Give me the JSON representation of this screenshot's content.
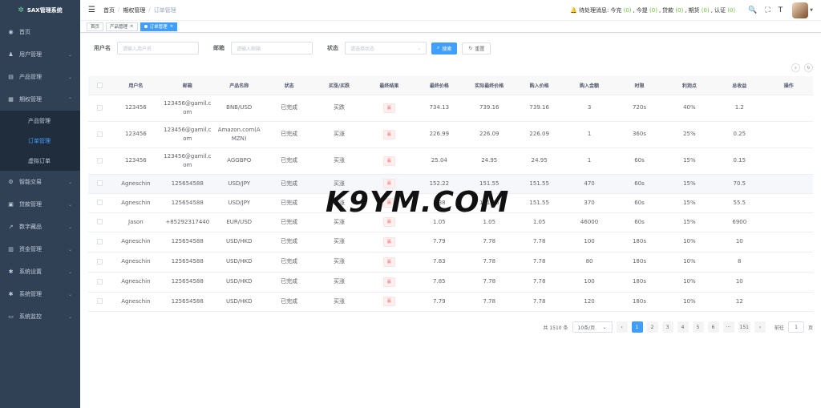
{
  "app": {
    "title": "SAX管理系统"
  },
  "sidebar": {
    "items": [
      {
        "label": "首页",
        "icon": "dashboard-icon"
      },
      {
        "label": "用户管理",
        "icon": "user-icon"
      },
      {
        "label": "产品管理",
        "icon": "document-icon"
      },
      {
        "label": "期权管理",
        "icon": "chart-icon",
        "open": true,
        "children": [
          "产品管理",
          "订单管理",
          "虚拟订单"
        ],
        "active_child": 1
      },
      {
        "label": "智能交易",
        "icon": "gear-icon"
      },
      {
        "label": "贷款管理",
        "icon": "money-icon"
      },
      {
        "label": "数字藏品",
        "icon": "trend-icon"
      },
      {
        "label": "资金管理",
        "icon": "wallet-icon"
      },
      {
        "label": "系统设置",
        "icon": "settings-icon"
      },
      {
        "label": "系统管理",
        "icon": "settings-icon"
      },
      {
        "label": "系统监控",
        "icon": "monitor-icon"
      }
    ]
  },
  "navbar": {
    "breadcrumb": [
      "首页",
      "期权管理",
      "订单管理"
    ],
    "pending": {
      "prefix": "待处理消息:今充",
      "items": [
        {
          "label": "今充",
          "count": "(0)"
        },
        {
          "label": "今提",
          "count": "(0)"
        },
        {
          "label": "贷款",
          "count": "(0)"
        },
        {
          "label": "期货",
          "count": "(0)"
        },
        {
          "label": "认证",
          "count": "(0)"
        }
      ]
    }
  },
  "tags": [
    {
      "label": "首页",
      "active": false
    },
    {
      "label": "产品管理",
      "active": false
    },
    {
      "label": "订单管理",
      "active": true
    }
  ],
  "filters": {
    "username_label": "用户名",
    "username_placeholder": "请输入用户名",
    "email_label": "邮箱",
    "email_placeholder": "请输入邮箱",
    "status_label": "状态",
    "status_placeholder": "请选择状态",
    "search_label": "搜索",
    "reset_label": "重置"
  },
  "table": {
    "columns": [
      "用户名",
      "邮箱",
      "产品名称",
      "状态",
      "买涨/买跌",
      "最终结果",
      "最终价格",
      "实际最终价格",
      "购入价格",
      "购入金额",
      "时限",
      "利润点",
      "总收益",
      "操作"
    ],
    "rows": [
      [
        "123456",
        "123456@gamil.com",
        "BNB/USD",
        "已完成",
        "买跌",
        "赢",
        "734.13",
        "739.16",
        "739.16",
        "3",
        "720s",
        "40%",
        "1.2"
      ],
      [
        "123456",
        "123456@gamil.com",
        "Amazon.com(AMZN)",
        "已完成",
        "买涨",
        "赢",
        "226.99",
        "226.09",
        "226.09",
        "1",
        "360s",
        "25%",
        "0.25"
      ],
      [
        "123456",
        "123456@gamil.com",
        "AGGBPO",
        "已完成",
        "买涨",
        "赢",
        "25.04",
        "24.95",
        "24.95",
        "1",
        "60s",
        "15%",
        "0.15"
      ],
      [
        "Agneschin",
        "125654588",
        "USD/JPY",
        "已完成",
        "买涨",
        "赢",
        "152.22",
        "151.55",
        "151.55",
        "470",
        "60s",
        "15%",
        "70.5"
      ],
      [
        "Agneschin",
        "125654588",
        "USD/JPY",
        "已完成",
        "买涨",
        "赢",
        "1.38",
        "151.55",
        "151.55",
        "370",
        "60s",
        "15%",
        "55.5"
      ],
      [
        "Jason",
        "+85292317440",
        "EUR/USD",
        "已完成",
        "买涨",
        "赢",
        "1.05",
        "1.05",
        "1.05",
        "46000",
        "60s",
        "15%",
        "6900"
      ],
      [
        "Agneschin",
        "125654588",
        "USD/HKD",
        "已完成",
        "买涨",
        "赢",
        "7.79",
        "7.78",
        "7.78",
        "100",
        "180s",
        "10%",
        "10"
      ],
      [
        "Agneschin",
        "125654588",
        "USD/HKD",
        "已完成",
        "买涨",
        "赢",
        "7.83",
        "7.78",
        "7.78",
        "80",
        "180s",
        "10%",
        "8"
      ],
      [
        "Agneschin",
        "125654588",
        "USD/HKD",
        "已完成",
        "买涨",
        "赢",
        "7.85",
        "7.78",
        "7.78",
        "100",
        "180s",
        "10%",
        "10"
      ],
      [
        "Agneschin",
        "125654588",
        "USD/HKD",
        "已完成",
        "买涨",
        "赢",
        "7.79",
        "7.78",
        "7.78",
        "120",
        "180s",
        "10%",
        "12"
      ]
    ],
    "highlight_row": 3
  },
  "pagination": {
    "total": "共 1510 条",
    "page_size": "10条/页",
    "pages": [
      "1",
      "2",
      "3",
      "4",
      "5",
      "6",
      "···",
      "151"
    ],
    "current": "1",
    "goto_prefix": "前往",
    "goto_value": "1",
    "goto_suffix": "页"
  },
  "watermark": "K9YM.COM",
  "colors": {
    "sidebar": "#304156",
    "primary": "#409eff",
    "danger": "#f56c6c",
    "success": "#67c23a"
  }
}
